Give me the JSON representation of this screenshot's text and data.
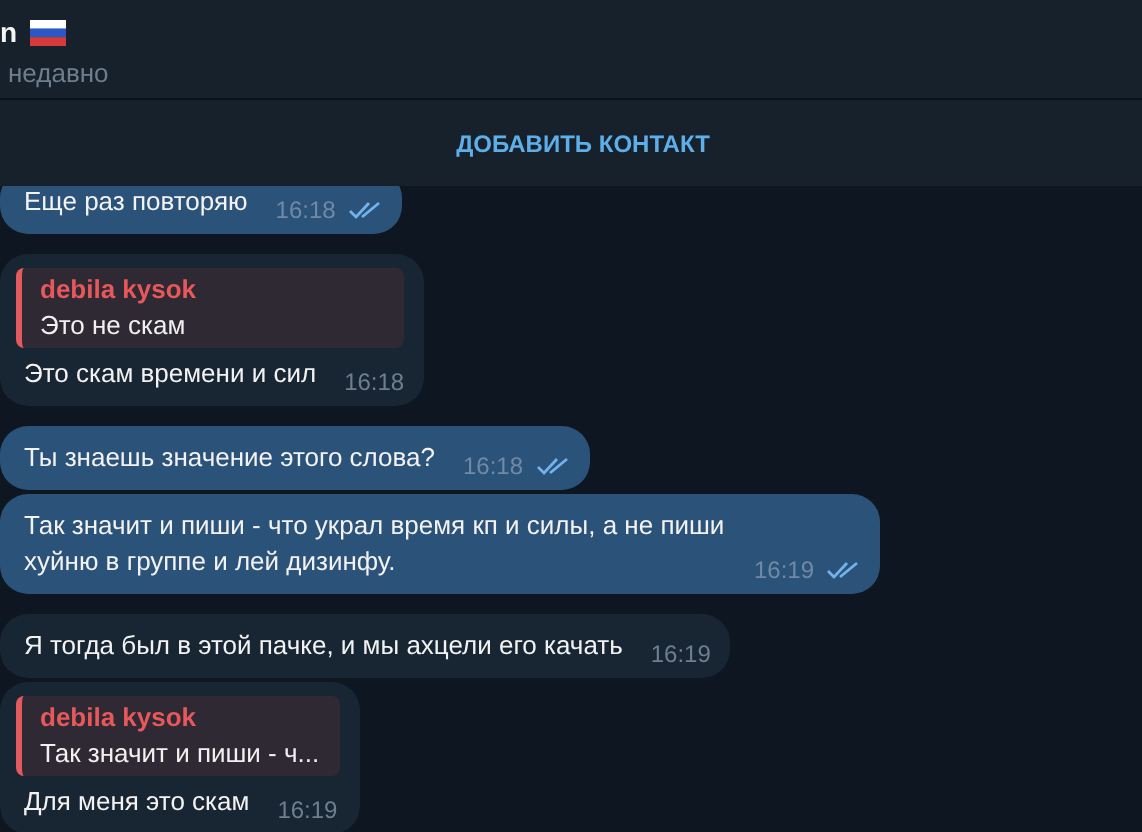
{
  "header": {
    "name": "n",
    "status": "недавно"
  },
  "add_contact": {
    "label": "ДОБАВИТЬ КОНТАКТ"
  },
  "messages": [
    {
      "kind": "out",
      "text": "Еще раз повторяю",
      "time": "16:18",
      "read": true
    },
    {
      "kind": "in",
      "reply": {
        "author": "debila kysok",
        "text": "Это не скам"
      },
      "text": "Это скам времени и сил",
      "time": "16:18"
    },
    {
      "kind": "out",
      "text": "Ты знаешь значение этого слова?",
      "time": "16:18",
      "read": true
    },
    {
      "kind": "out",
      "text": "Так значит и пиши - что украл время кп и силы, а не пиши хуйню в группе и лей дизинфу.",
      "time": "16:19",
      "read": true
    },
    {
      "kind": "in",
      "text": "Я тогда был в этой пачке, и мы ахцели его качать",
      "time": "16:19"
    },
    {
      "kind": "in",
      "reply": {
        "author": "debila kysok",
        "text": "Так значит и пиши - ч..."
      },
      "text": "Для меня это скам",
      "time": "16:19"
    }
  ]
}
